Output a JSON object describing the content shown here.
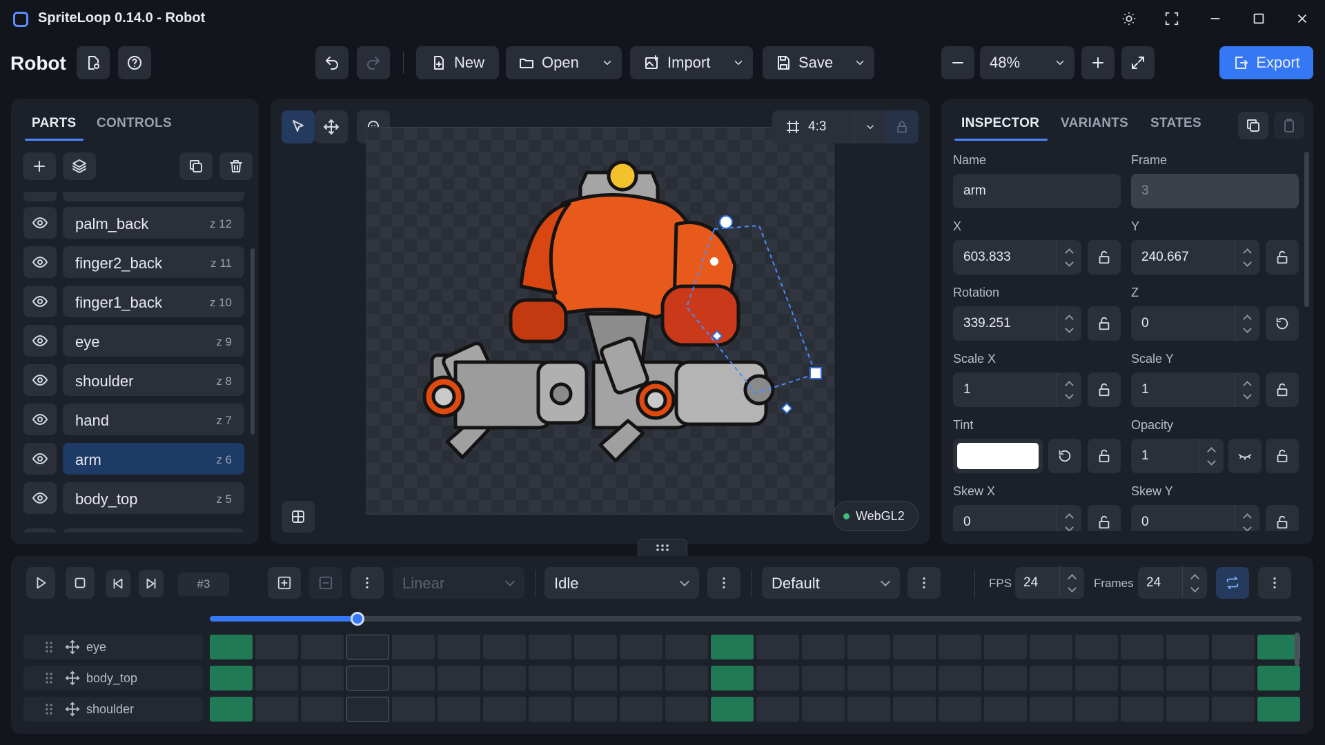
{
  "window": {
    "title": "SpriteLoop 0.14.0 - Robot"
  },
  "header": {
    "doc_name": "Robot"
  },
  "toolbar": {
    "new_label": "New",
    "open_label": "Open",
    "import_label": "Import",
    "save_label": "Save",
    "zoom": "48%",
    "export_label": "Export"
  },
  "parts_panel": {
    "tabs": [
      "PARTS",
      "CONTROLS"
    ],
    "items": [
      {
        "name": "palm_back",
        "z": "z 12"
      },
      {
        "name": "finger2_back",
        "z": "z 11"
      },
      {
        "name": "finger1_back",
        "z": "z 10"
      },
      {
        "name": "eye",
        "z": "z 9"
      },
      {
        "name": "shoulder",
        "z": "z 8"
      },
      {
        "name": "hand",
        "z": "z 7"
      },
      {
        "name": "arm",
        "z": "z 6",
        "selected": true
      },
      {
        "name": "body_top",
        "z": "z 5"
      }
    ]
  },
  "canvas": {
    "aspect": "4:3",
    "renderer": "WebGL2"
  },
  "inspector": {
    "tabs": [
      "INSPECTOR",
      "VARIANTS",
      "STATES"
    ],
    "name_label": "Name",
    "name_value": "arm",
    "frame_label": "Frame",
    "frame_value": "3",
    "x_label": "X",
    "x_value": "603.833",
    "y_label": "Y",
    "y_value": "240.667",
    "rotation_label": "Rotation",
    "rotation_value": "339.251",
    "z_label": "Z",
    "z_value": "0",
    "scalex_label": "Scale X",
    "scalex_value": "1",
    "scaley_label": "Scale Y",
    "scaley_value": "1",
    "tint_label": "Tint",
    "tint_color": "#ffffff",
    "opacity_label": "Opacity",
    "opacity_value": "1",
    "skewx_label": "Skew X",
    "skewx_value": "0",
    "skewy_label": "Skew Y",
    "skewy_value": "0"
  },
  "timeline": {
    "frame_indicator": "#3",
    "easing": "Linear",
    "animation": "Idle",
    "variant": "Default",
    "fps_label": "FPS",
    "fps_value": "24",
    "frames_label": "Frames",
    "frames_value": "24",
    "scrub_progress": 0.135,
    "tracks": [
      {
        "name": "eye",
        "keys": [
          0,
          11,
          23
        ]
      },
      {
        "name": "body_top",
        "keys": [
          0,
          11,
          23
        ]
      },
      {
        "name": "shoulder",
        "keys": [
          0,
          11,
          23
        ]
      }
    ]
  },
  "colors": {
    "accent": "#3578f6",
    "keyframe": "#1f7a55",
    "selection": "#1e3a66"
  }
}
